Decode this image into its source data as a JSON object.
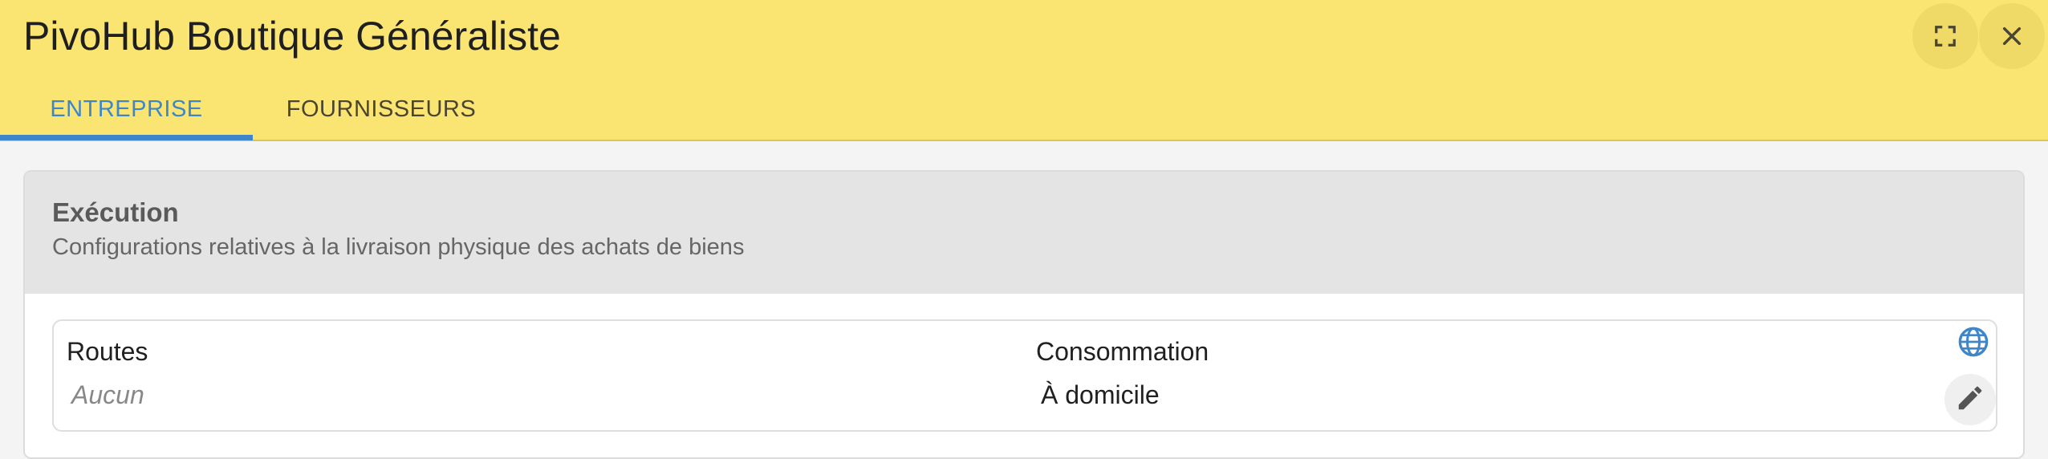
{
  "header": {
    "title": "PivoHub Boutique Généraliste",
    "expand_icon": "fullscreen-icon",
    "close_icon": "close-icon",
    "background": "#fae573"
  },
  "tabs": [
    {
      "label": "ENTREPRISE",
      "active": true
    },
    {
      "label": "FOURNISSEURS",
      "active": false
    }
  ],
  "accent_color": "#3e86c8",
  "section": {
    "title": "Exécution",
    "description": "Configurations relatives à la livraison physique des achats de biens"
  },
  "fields": [
    {
      "label": "Routes",
      "value": "Aucun",
      "empty": true
    },
    {
      "label": "Consommation",
      "value": "À domicile",
      "empty": false
    }
  ],
  "actions": {
    "globe_icon": "globe-icon",
    "edit_icon": "pencil-icon"
  }
}
